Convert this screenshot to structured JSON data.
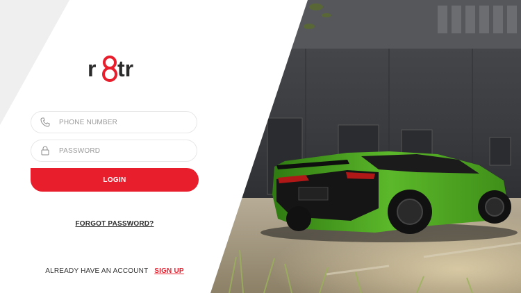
{
  "brand": {
    "logo_text": "r8tr",
    "accent_color": "#e81e2d"
  },
  "form": {
    "phone_placeholder": "PHONE NUMBER",
    "password_placeholder": "PASSWORD",
    "login_label": "LOGIN",
    "forgot_label": "FORGOT PASSWORD?"
  },
  "footer": {
    "prompt": "ALREADY HAVE AN ACCOUNT",
    "signup_label": "SIGN UP"
  },
  "hero": {
    "description": "green sports car photo"
  }
}
